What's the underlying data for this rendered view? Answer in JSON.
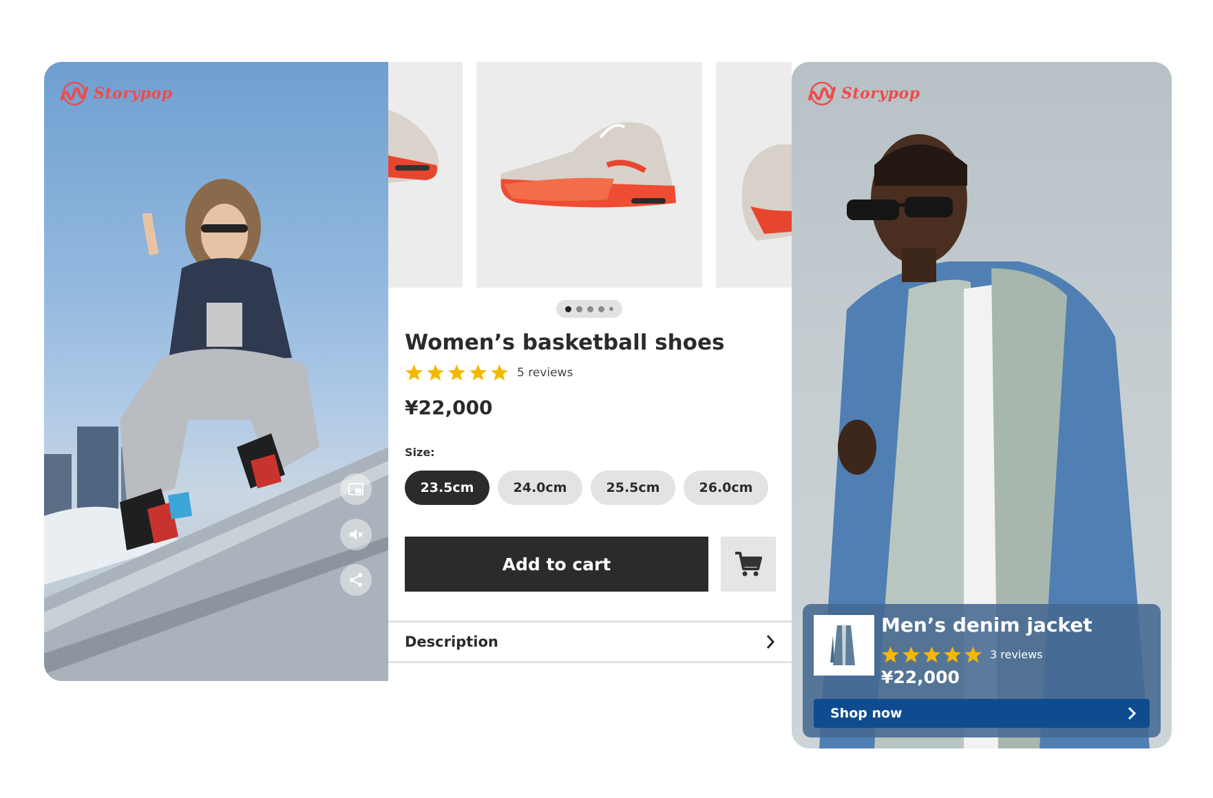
{
  "brand": {
    "name": "Storypop",
    "color": "#ef4b4b"
  },
  "left_story": {
    "controls": [
      {
        "icon": "picture-in-picture-icon"
      },
      {
        "icon": "mute-icon"
      },
      {
        "icon": "share-icon"
      }
    ]
  },
  "product": {
    "title": "Women’s basketball shoes",
    "rating": 5,
    "reviews": "5 reviews",
    "price": "¥22,000",
    "size_label": "Size:",
    "sizes": [
      "23.5cm",
      "24.0cm",
      "25.5cm",
      "26.0cm"
    ],
    "selected_size": "23.5cm",
    "add_to_cart_label": "Add to cart",
    "cart_icon": "cart-icon",
    "description_label": "Description",
    "carousel": {
      "total": 5,
      "active": 1
    }
  },
  "right_story": {
    "title": "Men’s denim jacket",
    "rating": 5,
    "reviews": "3 reviews",
    "price": "¥22,000",
    "shop_label": "Shop now"
  },
  "colors": {
    "dark_button": "#2b2b2b",
    "star": "#f5b800",
    "shop_button": "#0f4b8f",
    "card_overlay": "#46698f"
  }
}
